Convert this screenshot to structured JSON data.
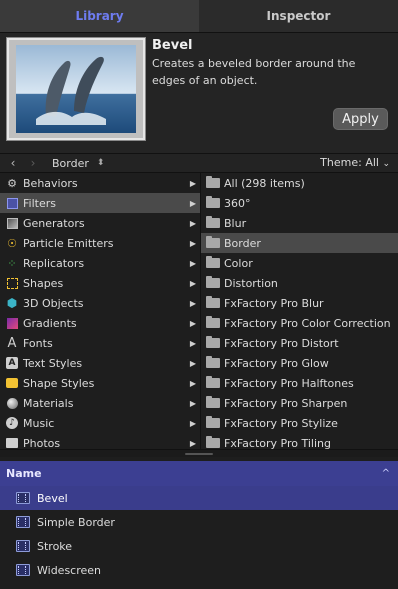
{
  "tabs": [
    {
      "label": "Library",
      "active": true
    },
    {
      "label": "Inspector",
      "active": false
    }
  ],
  "preview": {
    "title": "Bevel",
    "description": "Creates a beveled border around the edges of an object.",
    "apply_label": "Apply",
    "thumbnail_icon": "dolphins-image"
  },
  "nav": {
    "back_icon": "chevron-left-icon",
    "forward_icon": "chevron-right-icon",
    "breadcrumb": "Border",
    "breadcrumb_icon": "updown-icon",
    "theme_label": "Theme: All",
    "theme_icon": "chevron-down-icon"
  },
  "categories": [
    {
      "label": "Behaviors",
      "icon": "gear-icon",
      "icon_color": "#cfcfcf",
      "selected": false
    },
    {
      "label": "Filters",
      "icon": "filter-icon",
      "icon_color": "#7f86e6",
      "selected": true
    },
    {
      "label": "Generators",
      "icon": "generator-icon",
      "icon_color": "#bdbdbd",
      "selected": false
    },
    {
      "label": "Particle Emitters",
      "icon": "particle-icon",
      "icon_color": "#f2c233",
      "selected": false
    },
    {
      "label": "Replicators",
      "icon": "replicator-icon",
      "icon_color": "#4ecb5c",
      "selected": false
    },
    {
      "label": "Shapes",
      "icon": "shape-icon",
      "icon_color": "#f2c233",
      "selected": false
    },
    {
      "label": "3D Objects",
      "icon": "cube-icon",
      "icon_color": "#3bb4c7",
      "selected": false
    },
    {
      "label": "Gradients",
      "icon": "gradient-icon",
      "icon_color": "#c7418c",
      "selected": false
    },
    {
      "label": "Fonts",
      "icon": "font-icon",
      "icon_color": "#cfcfcf",
      "selected": false
    },
    {
      "label": "Text Styles",
      "icon": "text-style-icon",
      "icon_color": "#cfcfcf",
      "selected": false
    },
    {
      "label": "Shape Styles",
      "icon": "shape-style-icon",
      "icon_color": "#f2c233",
      "selected": false
    },
    {
      "label": "Materials",
      "icon": "material-icon",
      "icon_color": "#cfcfcf",
      "selected": false
    },
    {
      "label": "Music",
      "icon": "music-icon",
      "icon_color": "#cfcfcf",
      "selected": false
    },
    {
      "label": "Photos",
      "icon": "photo-icon",
      "icon_color": "#cfcfcf",
      "selected": false
    }
  ],
  "subcategories": [
    {
      "label": "All (298 items)",
      "selected": false
    },
    {
      "label": "360°",
      "selected": false
    },
    {
      "label": "Blur",
      "selected": false
    },
    {
      "label": "Border",
      "selected": true
    },
    {
      "label": "Color",
      "selected": false
    },
    {
      "label": "Distortion",
      "selected": false
    },
    {
      "label": "FxFactory Pro Blur",
      "selected": false
    },
    {
      "label": "FxFactory Pro Color Correction",
      "selected": false
    },
    {
      "label": "FxFactory Pro Distort",
      "selected": false
    },
    {
      "label": "FxFactory Pro Glow",
      "selected": false
    },
    {
      "label": "FxFactory Pro Halftones",
      "selected": false
    },
    {
      "label": "FxFactory Pro Sharpen",
      "selected": false
    },
    {
      "label": "FxFactory Pro Stylize",
      "selected": false
    },
    {
      "label": "FxFactory Pro Tiling",
      "selected": false
    }
  ],
  "list": {
    "header": "Name",
    "sort_icon": "chevron-up-icon",
    "items": [
      {
        "label": "Bevel",
        "selected": true
      },
      {
        "label": "Simple Border",
        "selected": false
      },
      {
        "label": "Stroke",
        "selected": false
      },
      {
        "label": "Widescreen",
        "selected": false
      }
    ]
  },
  "colors": {
    "accent": "#6e7cf0",
    "selection_blue": "#3a3d8c",
    "header_blue": "#3c3f92"
  }
}
